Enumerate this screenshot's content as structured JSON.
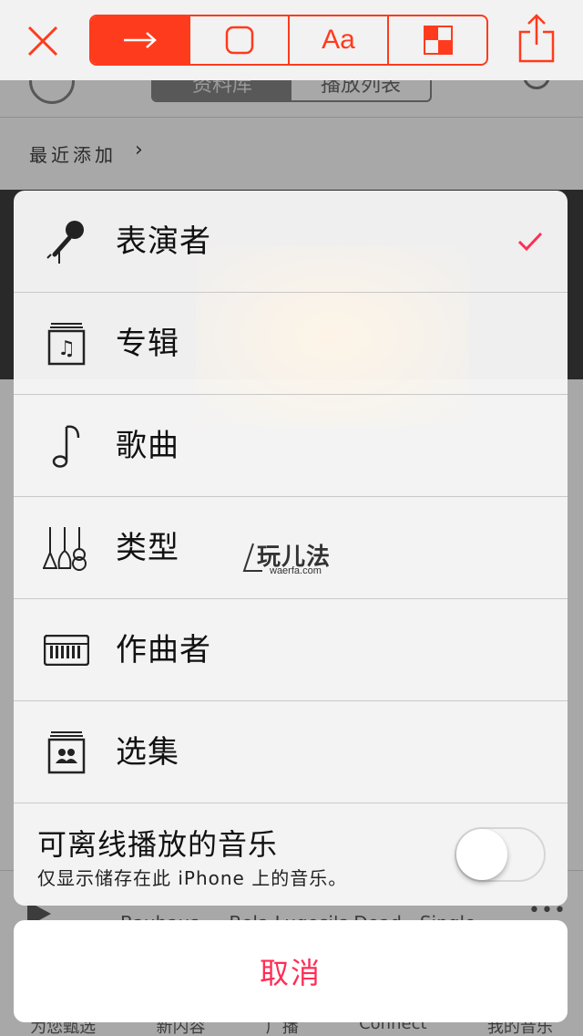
{
  "toolbar": {
    "close_icon": "close-x-icon",
    "segments": [
      {
        "icon": "arrow-icon",
        "active": true
      },
      {
        "icon": "rounded-square-icon",
        "active": false
      },
      {
        "icon": "text-icon",
        "label": "Aa",
        "active": false
      },
      {
        "icon": "magnifier-grid-icon",
        "active": false
      }
    ],
    "share_icon": "share-icon",
    "accent": "#ff3b1d"
  },
  "background": {
    "seg_left": "资料库",
    "seg_right": "播放列表",
    "recent_label": "最近添加",
    "now_playing": "Bauhaus — Bela Lugosi's Dead - Single",
    "tabs": [
      "为您甄选",
      "新内容",
      "广播",
      "Connect",
      "我的音乐"
    ]
  },
  "sheet": {
    "items": [
      {
        "label": "表演者",
        "icon": "microphone-icon",
        "checked": true
      },
      {
        "label": "专辑",
        "icon": "album-icon",
        "checked": false
      },
      {
        "label": "歌曲",
        "icon": "music-note-icon",
        "checked": false
      },
      {
        "label": "类型",
        "icon": "guitars-icon",
        "checked": false
      },
      {
        "label": "作曲者",
        "icon": "piano-keyboard-icon",
        "checked": false
      },
      {
        "label": "选集",
        "icon": "compilation-icon",
        "checked": false
      }
    ],
    "offline": {
      "title": "可离线播放的音乐",
      "subtitle": "仅显示储存在此 iPhone 上的音乐。",
      "toggle_on": false
    },
    "check_color": "#ff2d55"
  },
  "watermark": {
    "main": "玩儿法",
    "sub": "waerfa.com"
  },
  "cancel_label": "取消",
  "cancel_color": "#ff2d55"
}
